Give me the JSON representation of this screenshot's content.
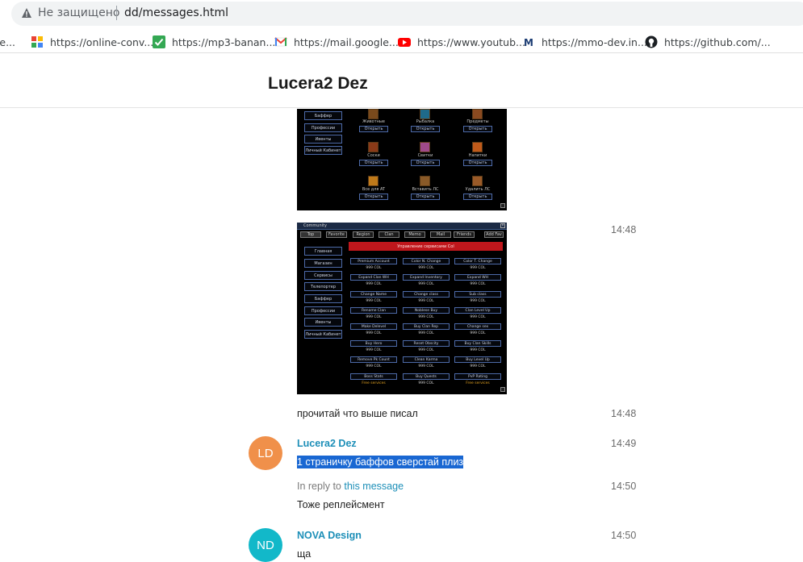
{
  "browser": {
    "security_label": "Не защищено",
    "url": "dd/messages.html",
    "bookmarks": [
      {
        "label": "ve...",
        "icon": "none"
      },
      {
        "label": "https://online-conv...",
        "icon": "online-convert-icon"
      },
      {
        "label": "https://mp3-banan...",
        "icon": "checkmark-icon"
      },
      {
        "label": "https://mail.google....",
        "icon": "gmail-icon"
      },
      {
        "label": "https://www.youtub...",
        "icon": "youtube-icon"
      },
      {
        "label": "https://mmo-dev.in...",
        "icon": "mmo-dev-icon"
      },
      {
        "label": "https://github.com/...",
        "icon": "github-icon"
      }
    ]
  },
  "header": {
    "title": "Lucera2 Dez"
  },
  "colors": {
    "link": "#1d8fb8",
    "selection": "#1967d2",
    "avatar_ld": "#f0904a",
    "avatar_nd": "#12b8c9"
  },
  "shot1": {
    "side": [
      "Баффер",
      "Профессии",
      "Ивенты",
      "Личный Кабинет"
    ],
    "cells": [
      {
        "label": "Животные",
        "btn": "Открыть"
      },
      {
        "label": "Рыбалка",
        "btn": "Открыть"
      },
      {
        "label": "Предметы",
        "btn": "Открыть"
      },
      {
        "label": "Соски",
        "btn": "Открыть"
      },
      {
        "label": "Свитки",
        "btn": "Открыть"
      },
      {
        "label": "Напитки",
        "btn": "Открыть"
      },
      {
        "label": "Все для AT",
        "btn": "Открыть"
      },
      {
        "label": "Вставить ЛС",
        "btn": "Открыть"
      },
      {
        "label": "Удалить ЛС",
        "btn": "Открыть"
      }
    ]
  },
  "shot2": {
    "window_title": "Community",
    "tabs": [
      "Top",
      "Favorite",
      "Region",
      "Clan",
      "Memo",
      "Mail",
      "Friends"
    ],
    "add_fav": "Add Fav",
    "banner": "Управление сервисами Col",
    "side": [
      "Главная",
      "Магазин",
      "Сервисы",
      "Телепортер",
      "Баффер",
      "Профессии",
      "Ивенты",
      "Личный Кабинет"
    ],
    "services": [
      {
        "name": "Premium Account",
        "price": "999 COL"
      },
      {
        "name": "Color N. Change",
        "price": "999 COL"
      },
      {
        "name": "Color T. Change",
        "price": "999 COL"
      },
      {
        "name": "Expand Clan WH",
        "price": "999 COL"
      },
      {
        "name": "Expand Inventory",
        "price": "999 COL"
      },
      {
        "name": "Expand WH",
        "price": "999 COL"
      },
      {
        "name": "Change Name",
        "price": "999 COL"
      },
      {
        "name": "Change class",
        "price": "999 COL"
      },
      {
        "name": "Sub class",
        "price": "999 COL"
      },
      {
        "name": "Rename Clan",
        "price": "999 COL"
      },
      {
        "name": "Noblese Buy",
        "price": "999 COL"
      },
      {
        "name": "Clan Level Up",
        "price": "999 COL"
      },
      {
        "name": "Make Delevel",
        "price": "999 COL"
      },
      {
        "name": "Buy Clan Rep",
        "price": "999 COL"
      },
      {
        "name": "Change sex",
        "price": "999 COL"
      },
      {
        "name": "Buy Hero",
        "price": "999 COL"
      },
      {
        "name": "Reset Obscity",
        "price": "999 COL"
      },
      {
        "name": "Buy Clan Skills",
        "price": "999 COL"
      },
      {
        "name": "Remove Pk Count",
        "price": "999 COL"
      },
      {
        "name": "Clean Karma",
        "price": "999 COL"
      },
      {
        "name": "Buy Level Up",
        "price": "999 COL"
      },
      {
        "name": "Boss Stats",
        "price": "Free services"
      },
      {
        "name": "Buy Quests",
        "price": "999 COL"
      },
      {
        "name": "PvP Rating",
        "price": "Free services"
      }
    ]
  },
  "messages": [
    {
      "time": "14:48"
    },
    {
      "text": "прочитай что выше писал",
      "time": "14:48"
    },
    {
      "avatar": "LD",
      "author": "Lucera2 Dez",
      "time": "14:49",
      "text": "1 страничку баффов сверстай плиз"
    },
    {
      "reply_prefix": "In reply to",
      "reply_link": "this message",
      "time": "14:50",
      "text": "Тоже реплейсмент"
    },
    {
      "avatar": "ND",
      "author": "NOVA Design",
      "time": "14:50",
      "text": "ща"
    }
  ]
}
